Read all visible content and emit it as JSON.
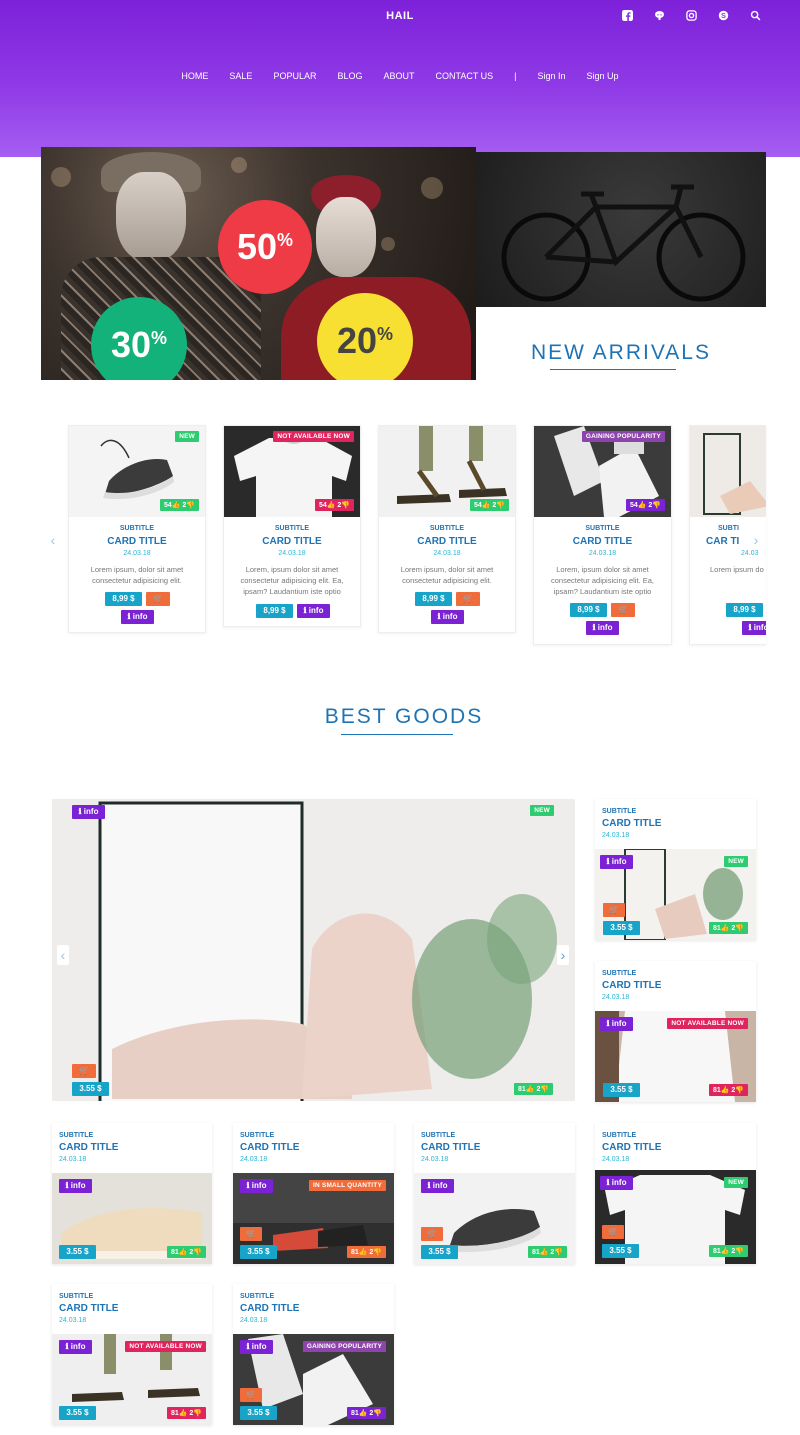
{
  "header": {
    "brand": "HAIL",
    "nav": [
      "HOME",
      "SALE",
      "POPULAR",
      "BLOG",
      "ABOUT",
      "CONTACT US",
      "|",
      "Sign In",
      "Sign Up"
    ],
    "social": [
      "facebook-icon",
      "github-icon",
      "instagram-icon",
      "skype-icon",
      "search-icon"
    ]
  },
  "hero": {
    "discounts": [
      "50",
      "30",
      "20"
    ],
    "percent": "%"
  },
  "arrivals": {
    "title": "NEW ARRIVALS",
    "cards": [
      {
        "tag": "NEW",
        "likes": "54👍 2👎",
        "subtitle": "SUBTITLE",
        "title": "CARD TITLE",
        "date": "24.03.18",
        "text": "Lorem ipsum, dolor sit amet consectetur adipisicing elit.",
        "price": "8,99 $",
        "info": "info"
      },
      {
        "tag": "NOT AVAILABLE NOW",
        "likes": "54👍 2👎",
        "subtitle": "SUBTITLE",
        "title": "CARD TITLE",
        "date": "24.03.18",
        "text": "Lorem, ipsum dolor sit amet consectetur adipisicing elit. Ea, ipsam? Laudantium iste optio",
        "price": "8,99 $",
        "info": "info"
      },
      {
        "tag": "",
        "likes": "54👍 2👎",
        "subtitle": "SUBTITLE",
        "title": "CARD TITLE",
        "date": "24.03.18",
        "text": "Lorem ipsum, dolor sit amet consectetur adipisicing elit.",
        "price": "8,99 $",
        "info": "info"
      },
      {
        "tag": "GAINING POPULARITY",
        "likes": "54👍 2👎",
        "subtitle": "SUBTITLE",
        "title": "CARD TITLE",
        "date": "24.03.18",
        "text": "Lorem, ipsum dolor sit amet consectetur adipisicing elit. Ea, ipsam? Laudantium iste optio",
        "price": "8,99 $",
        "info": "info"
      },
      {
        "tag": "",
        "likes": "",
        "subtitle": "SUBTI",
        "title": "CAR TI",
        "date": "24.03",
        "text": "Lorem ipsum do consectetur adi",
        "price": "8,99 $",
        "info": "info"
      }
    ]
  },
  "best": {
    "title": "BEST GOODS",
    "featured": {
      "info": "info",
      "tag": "NEW",
      "price": "3.55 $",
      "likes": "81👍 2👎"
    },
    "side": [
      {
        "subtitle": "SUBTITLE",
        "title": "CARD TITLE",
        "date": "24.03.18",
        "info": "info",
        "tag": "NEW",
        "price": "3.55 $",
        "likes": "81👍 2👎"
      },
      {
        "subtitle": "SUBTITLE",
        "title": "CARD TITLE",
        "date": "24.03.18",
        "info": "info",
        "tag": "NOT AVAILABLE NOW",
        "price": "3.55 $",
        "likes": "81👍 2👎"
      }
    ],
    "grid": [
      {
        "subtitle": "SUBTITLE",
        "title": "CARD TITLE",
        "date": "24.03.18",
        "info": "info",
        "tag": "",
        "price": "3.55 $",
        "likes": "81👍 2👎"
      },
      {
        "subtitle": "SUBTITLE",
        "title": "CARD TITLE",
        "date": "24.03.18",
        "info": "info",
        "tag": "IN SMALL QUANTITY",
        "price": "3.55 $",
        "likes": "81👍 2👎"
      },
      {
        "subtitle": "SUBTITLE",
        "title": "CARD TITLE",
        "date": "24.03.18",
        "info": "info",
        "tag": "",
        "price": "3.55 $",
        "likes": "81👍 2👎"
      },
      {
        "subtitle": "SUBTITLE",
        "title": "CARD TITLE",
        "date": "24.03.18",
        "info": "info",
        "tag": "NEW",
        "price": "3.55 $",
        "likes": "81👍 2👎"
      },
      {
        "subtitle": "SUBTITLE",
        "title": "CARD TITLE",
        "date": "24.03.18",
        "info": "info",
        "tag": "NOT AVAILABLE NOW",
        "price": "3.55 $",
        "likes": "81👍 2👎"
      },
      {
        "subtitle": "SUBTITLE",
        "title": "CARD TITLE",
        "date": "24.03.18",
        "info": "info",
        "tag": "GAINING POPULARITY",
        "price": "3.55 $",
        "likes": "81👍 2👎"
      }
    ]
  },
  "colors": {
    "accent": "#7d21d9",
    "blue": "#1e73b4",
    "cyan": "#17a4c8",
    "orange": "#f06c3a",
    "green": "#2ecc71",
    "red": "#e0245e",
    "purple": "#7b22d4"
  }
}
